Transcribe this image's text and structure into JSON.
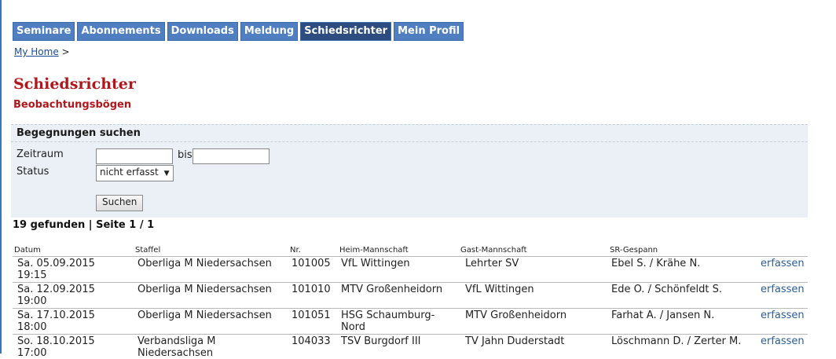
{
  "nav": {
    "tabs": [
      {
        "label": "Seminare",
        "active": false
      },
      {
        "label": "Abonnements",
        "active": false
      },
      {
        "label": "Downloads",
        "active": false
      },
      {
        "label": "Meldung",
        "active": false
      },
      {
        "label": "Schiedsrichter",
        "active": true
      },
      {
        "label": "Mein Profil",
        "active": false
      }
    ]
  },
  "breadcrumb": {
    "home": "My Home",
    "separator": ">"
  },
  "page": {
    "title": "Schiedsrichter",
    "subtitle": "Beobachtungsbögen"
  },
  "search": {
    "heading": "Begegnungen suchen",
    "zeitraum_label": "Zeitraum",
    "bis_label": "bis",
    "from_value": "",
    "to_value": "",
    "status_label": "Status",
    "status_selected": "nicht erfasst",
    "submit_label": "Suchen"
  },
  "results_summary": "19 gefunden | Seite 1 / 1",
  "table": {
    "headers": [
      "Datum",
      "Staffel",
      "Nr.",
      "Heim-Mannschaft",
      "Gast-Mannschaft",
      "SR-Gespann"
    ],
    "rows": [
      {
        "datum_line1": "Sa. 05.09.2015",
        "datum_line2": "19:15",
        "staffel_line1": "Oberliga M Niedersachsen",
        "staffel_line2": "",
        "nr": "101005",
        "heim_line1": "VfL Wittingen",
        "heim_line2": "",
        "gast": "Lehrter SV",
        "sr": "Ebel S. / Krähe N.",
        "action": "erfassen"
      },
      {
        "datum_line1": "Sa. 12.09.2015",
        "datum_line2": "19:00",
        "staffel_line1": "Oberliga M Niedersachsen",
        "staffel_line2": "",
        "nr": "101010",
        "heim_line1": "MTV Großenheidorn",
        "heim_line2": "",
        "gast": "VfL Wittingen",
        "sr": "Ede O. / Schönfeldt S.",
        "action": "erfassen"
      },
      {
        "datum_line1": "Sa. 17.10.2015",
        "datum_line2": "18:00",
        "staffel_line1": "Oberliga M Niedersachsen",
        "staffel_line2": "",
        "nr": "101051",
        "heim_line1": "HSG Schaumburg-",
        "heim_line2": "Nord",
        "gast": "MTV Großenheidorn",
        "sr": "Farhat A. / Jansen N.",
        "action": "erfassen"
      },
      {
        "datum_line1": "So. 18.10.2015",
        "datum_line2": "17:00",
        "staffel_line1": "Verbandsliga M",
        "staffel_line2": "Niedersachsen",
        "nr": "104033",
        "heim_line1": "TSV Burgdorf III",
        "heim_line2": "",
        "gast": "TV Jahn Duderstadt",
        "sr": "Löschmann D. / Zerter M.",
        "action": "erfassen"
      }
    ]
  }
}
